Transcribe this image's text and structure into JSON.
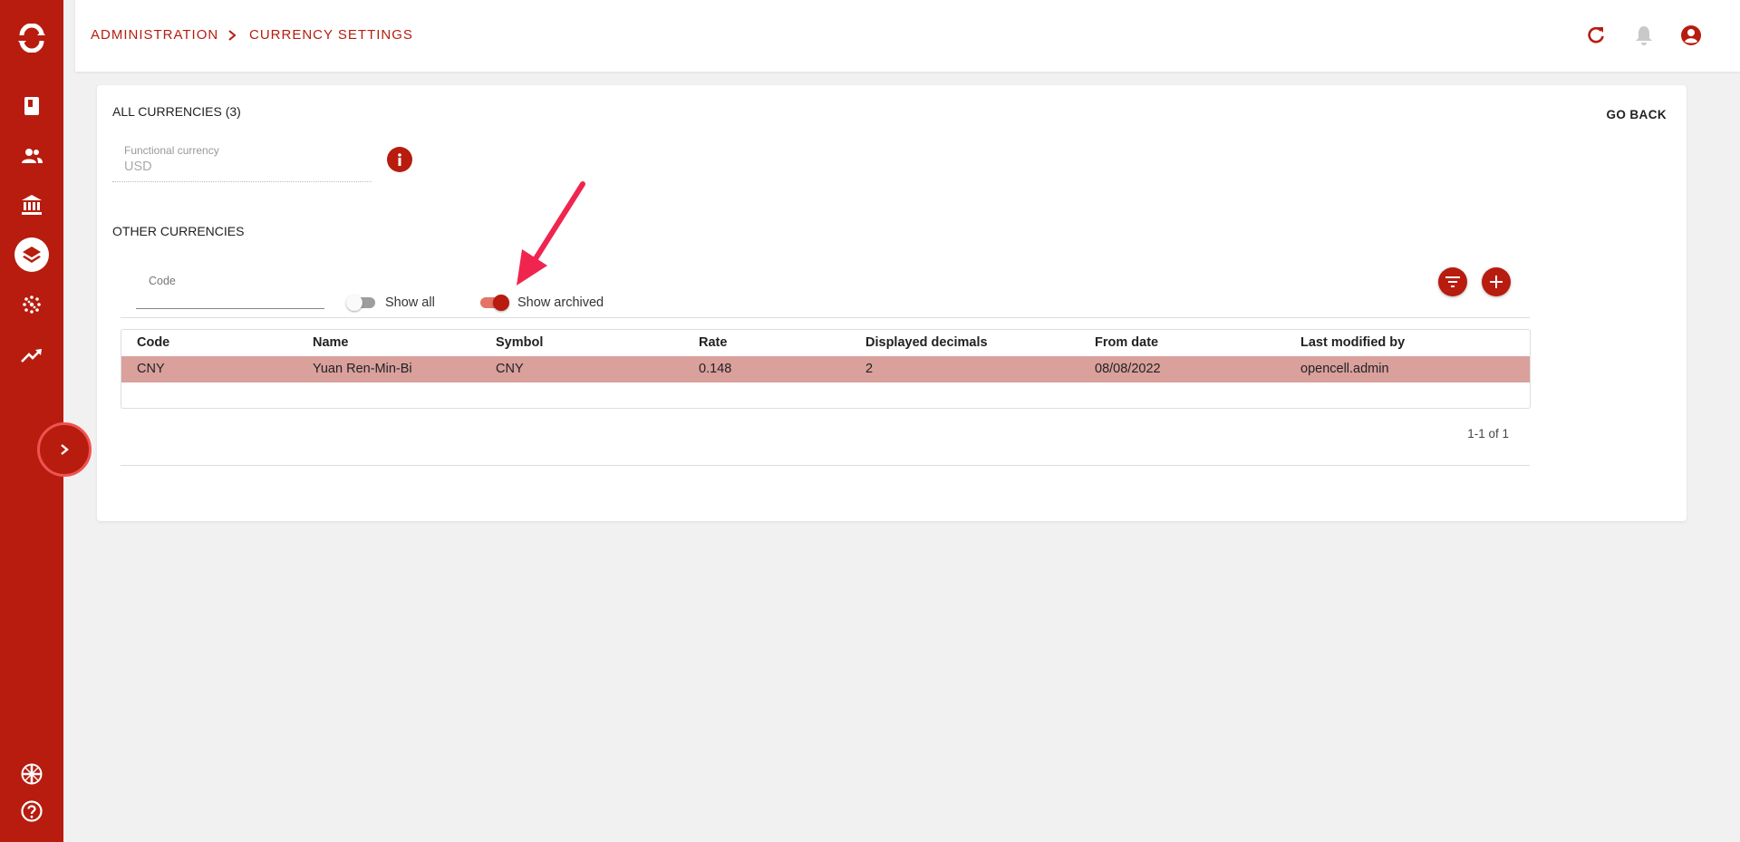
{
  "breadcrumb": {
    "items": [
      "ADMINISTRATION",
      "CURRENCY SETTINGS"
    ]
  },
  "card": {
    "title": "ALL CURRENCIES (3)",
    "go_back_label": "GO BACK",
    "functional_currency": {
      "label": "Functional currency",
      "value": "USD"
    },
    "other_currencies_title": "OTHER CURRENCIES"
  },
  "filters": {
    "code_label": "Code",
    "code_value": "",
    "show_all": {
      "label": "Show all",
      "checked": false
    },
    "show_archived": {
      "label": "Show archived",
      "checked": true
    }
  },
  "table": {
    "columns": [
      "Code",
      "Name",
      "Symbol",
      "Rate",
      "Displayed decimals",
      "From date",
      "Last modified by"
    ],
    "rows": [
      [
        "CNY",
        "Yuan Ren-Min-Bi",
        "CNY",
        "0.148",
        "2",
        "08/08/2022",
        "opencell.admin"
      ]
    ],
    "pagination": "1-1 of 1"
  },
  "colors": {
    "brand": "#b71c0f",
    "selected_row": "#d9a09c",
    "annotation_arrow": "#f0254f"
  },
  "icons": {
    "sidebar": [
      "opencell-logo-icon",
      "book-icon",
      "people-icon",
      "bank-icon",
      "layers-icon",
      "dots-grid-icon",
      "trending-up-icon",
      "globe-uk-flag-icon",
      "help-icon"
    ],
    "topbar": [
      "refresh-icon",
      "bell-icon",
      "account-circle-icon"
    ]
  }
}
